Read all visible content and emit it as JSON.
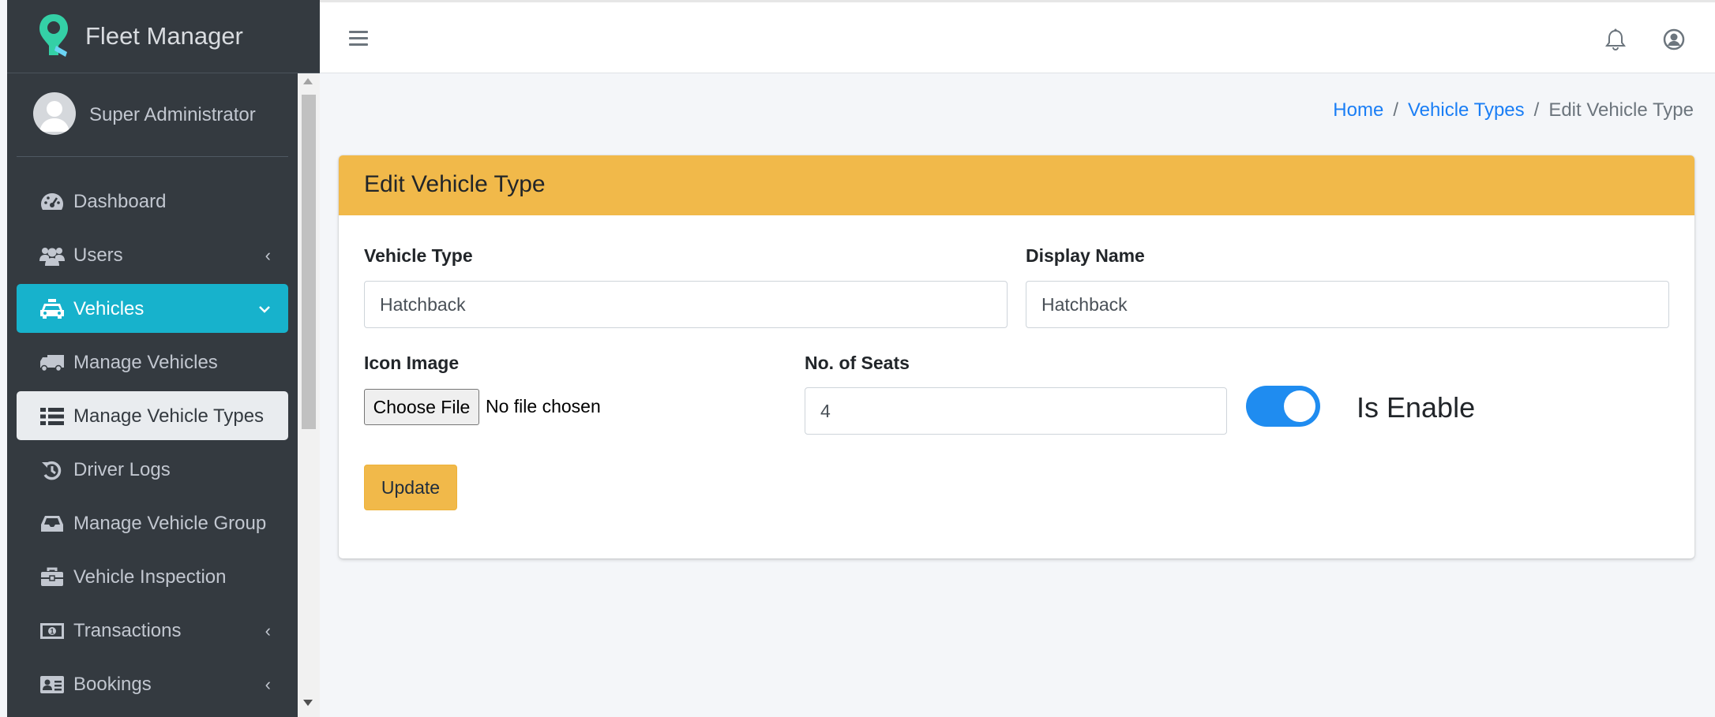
{
  "brand": {
    "title": "Fleet Manager"
  },
  "user": {
    "name": "Super Administrator"
  },
  "sidebar": {
    "items": [
      {
        "label": "Dashboard",
        "icon": "dashboard-icon",
        "arrow": ""
      },
      {
        "label": "Users",
        "icon": "users-icon",
        "arrow": "‹"
      },
      {
        "label": "Vehicles",
        "icon": "taxi-icon",
        "arrow": "⌄"
      },
      {
        "label": "Manage Vehicles",
        "icon": "truck-icon",
        "arrow": ""
      },
      {
        "label": "Manage Vehicle Types",
        "icon": "list-icon",
        "arrow": ""
      },
      {
        "label": "Driver Logs",
        "icon": "history-icon",
        "arrow": ""
      },
      {
        "label": "Manage Vehicle Group",
        "icon": "inbox-icon",
        "arrow": ""
      },
      {
        "label": "Vehicle Inspection",
        "icon": "briefcase-icon",
        "arrow": ""
      },
      {
        "label": "Transactions",
        "icon": "money-icon",
        "arrow": "‹"
      },
      {
        "label": "Bookings",
        "icon": "address-card-icon",
        "arrow": "‹"
      }
    ]
  },
  "breadcrumb": {
    "home": "Home",
    "parent": "Vehicle Types",
    "current": "Edit Vehicle Type",
    "sep": "/"
  },
  "card": {
    "title": "Edit Vehicle Type",
    "vehicle_type_label": "Vehicle Type",
    "vehicle_type_value": "Hatchback",
    "display_name_label": "Display Name",
    "display_name_value": "Hatchback",
    "icon_image_label": "Icon Image",
    "choose_file_label": "Choose File",
    "no_file_text": "No file chosen",
    "seats_label": "No. of Seats",
    "seats_value": "4",
    "enable_label": "Is Enable",
    "enable_on": true,
    "update_label": "Update"
  },
  "colors": {
    "accent": "#17b2cc",
    "warning": "#f1b94a",
    "toggle": "#1f8cf0",
    "sidebar": "#343a40"
  }
}
